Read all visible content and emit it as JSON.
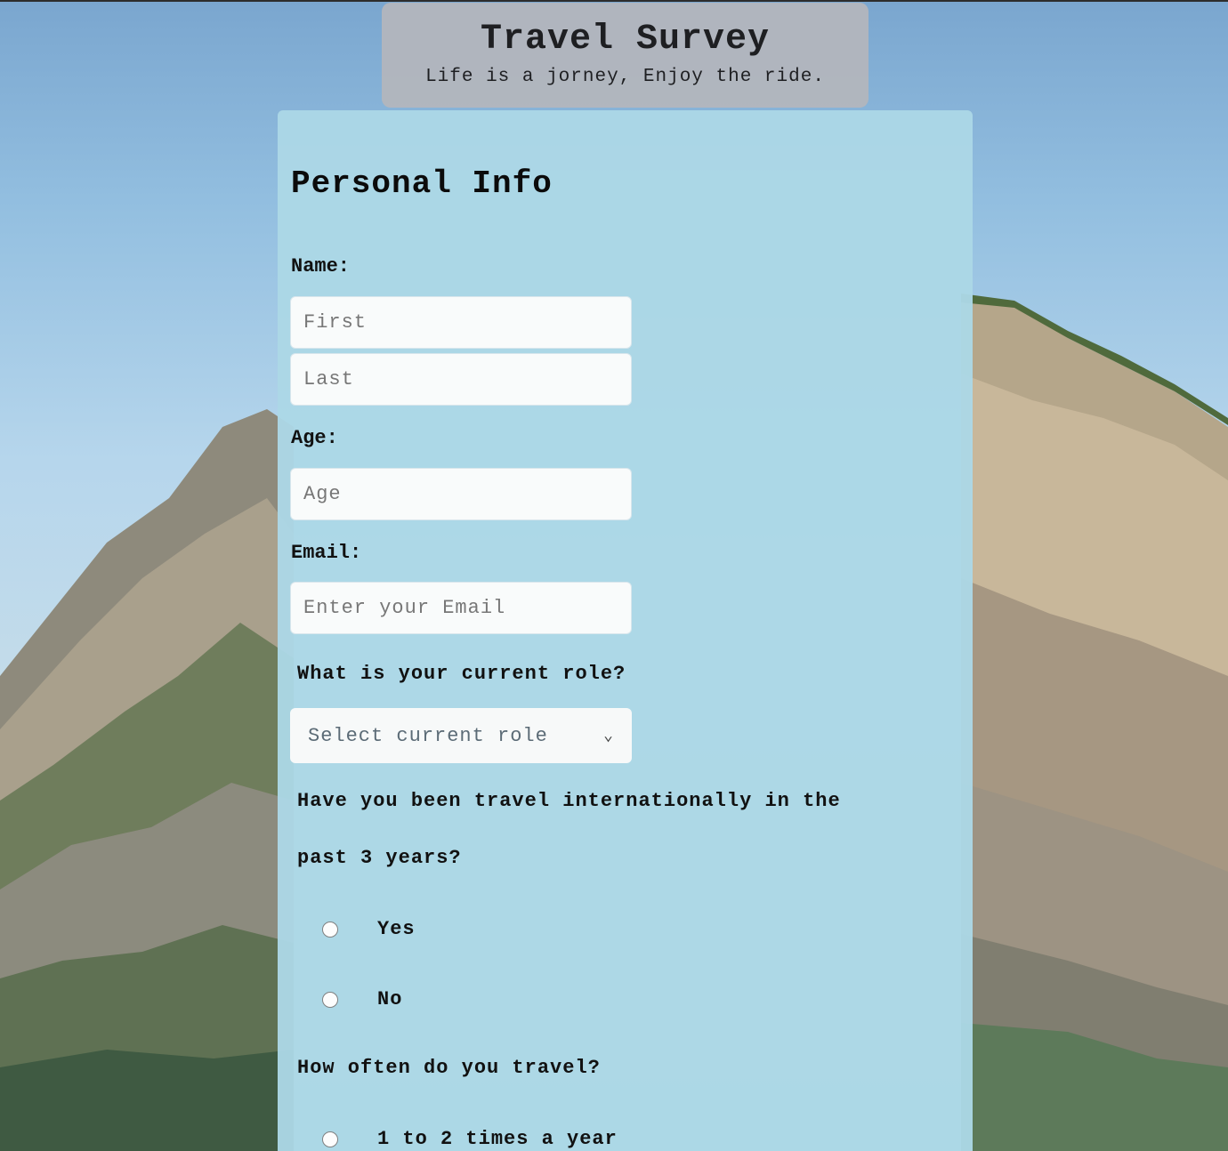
{
  "header": {
    "title": "Travel Survey",
    "subtitle": "Life is a jorney, Enjoy the ride."
  },
  "form": {
    "section_title": "Personal Info",
    "name_label": "Name:",
    "first_placeholder": "First",
    "last_placeholder": "Last",
    "age_label": "Age:",
    "age_placeholder": "Age",
    "email_label": "Email:",
    "email_placeholder": "Enter your Email",
    "role_question": "What is your current role?",
    "role_select_value": "Select current role",
    "intl_question_line1": "Have you been travel internationally in the",
    "intl_question_line2": "past 3 years?",
    "intl_options": [
      "Yes",
      "No"
    ],
    "frequency_question": "How often do you travel?",
    "frequency_options": [
      "1 to 2 times a year"
    ]
  },
  "icons": {
    "select_chevron": "chevron-down-icon"
  }
}
